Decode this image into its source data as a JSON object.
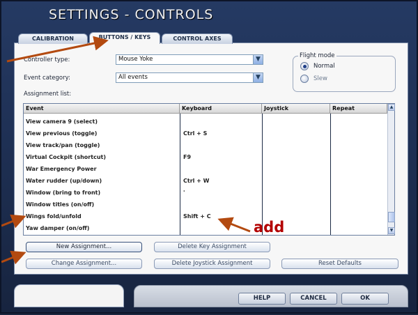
{
  "window": {
    "title": "SETTINGS - CONTROLS"
  },
  "tabs": [
    {
      "label": "CALIBRATION",
      "active": false
    },
    {
      "label": "BUTTONS / KEYS",
      "active": true
    },
    {
      "label": "CONTROL AXES",
      "active": false
    }
  ],
  "form": {
    "controller_type_label": "Controller type:",
    "controller_type_value": "Mouse Yoke",
    "event_category_label": "Event category:",
    "event_category_value": "All events",
    "assignment_list_label": "Assignment list:"
  },
  "flight_mode": {
    "title": "Flight mode",
    "options": [
      {
        "label": "Normal",
        "selected": true
      },
      {
        "label": "Slew",
        "selected": false
      }
    ]
  },
  "table": {
    "columns": [
      "Event",
      "Keyboard",
      "Joystick",
      "Repeat"
    ],
    "rows": [
      {
        "event": "View camera 9 (select)",
        "keyboard": ""
      },
      {
        "event": "View previous (toggle)",
        "keyboard": "Ctrl + S"
      },
      {
        "event": "View track/pan (toggle)",
        "keyboard": ""
      },
      {
        "event": "Virtual Cockpit (shortcut)",
        "keyboard": "F9"
      },
      {
        "event": "War Emergency Power",
        "keyboard": ""
      },
      {
        "event": "Water rudder (up/down)",
        "keyboard": "Ctrl + W"
      },
      {
        "event": "Window (bring to front)",
        "keyboard": "'"
      },
      {
        "event": "Window titles (on/off)",
        "keyboard": ""
      },
      {
        "event": "Wings fold/unfold",
        "keyboard": "Shift + C"
      },
      {
        "event": "Yaw damper (on/off)",
        "keyboard": ""
      }
    ]
  },
  "buttons": {
    "new_assignment": "New Assignment...",
    "delete_key_assignment": "Delete Key Assignment",
    "change_assignment": "Change Assignment...",
    "delete_joystick_assignment": "Delete Joystick Assignment",
    "reset_defaults": "Reset Defaults",
    "help": "HELP",
    "cancel": "CANCEL",
    "ok": "OK"
  },
  "annotation": {
    "text": "add",
    "color": "#b30000"
  },
  "colors": {
    "frame": "#1f3156",
    "panel": "#f7f7f7",
    "arrow": "#b34a10"
  }
}
